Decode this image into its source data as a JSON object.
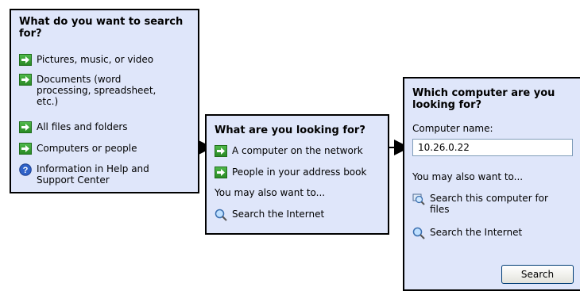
{
  "panel1": {
    "title": "What do you want to search for?",
    "items": [
      {
        "label": "Pictures, music, or video",
        "icon": "green-arrow-icon"
      },
      {
        "label": "Documents (word processing, spreadsheet, etc.)",
        "icon": "green-arrow-icon"
      },
      {
        "label": "All files and folders",
        "icon": "green-arrow-icon"
      },
      {
        "label": "Computers or people",
        "icon": "green-arrow-icon"
      },
      {
        "label": "Information in Help and Support Center",
        "icon": "help-icon"
      }
    ]
  },
  "panel2": {
    "title": "What are you looking for?",
    "items": [
      {
        "label": "A computer on the network",
        "icon": "green-arrow-icon"
      },
      {
        "label": "People in your address book",
        "icon": "green-arrow-icon"
      }
    ],
    "also_label": "You may also want to...",
    "also_items": [
      {
        "label": "Search the Internet",
        "icon": "internet-search-icon"
      }
    ]
  },
  "panel3": {
    "title": "Which computer are you looking for?",
    "field_label": "Computer name:",
    "field_value": "10.26.0.22",
    "also_label": "You may also want to...",
    "also_items": [
      {
        "label": "Search this computer for files",
        "icon": "computer-search-icon"
      },
      {
        "label": "Search the Internet",
        "icon": "internet-search-icon"
      }
    ],
    "button_label": "Search"
  },
  "colors": {
    "panel_bg": "#dfe6fa",
    "arrow_green": "#2f9a2a",
    "help_blue": "#2f62c8"
  }
}
